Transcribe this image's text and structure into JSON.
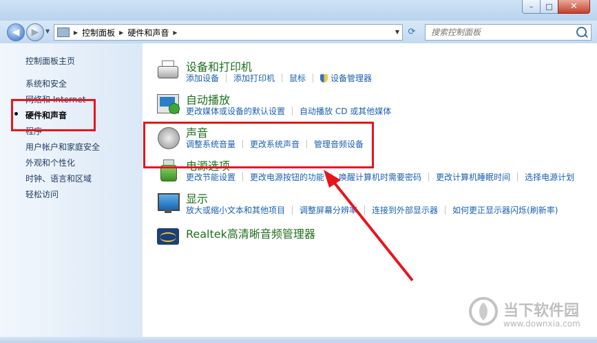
{
  "window": {
    "minimize": "–",
    "maximize": "□",
    "close": "✕"
  },
  "nav": {
    "breadcrumb": [
      "控制面板",
      "硬件和声音"
    ],
    "search_placeholder": "搜索控制面板"
  },
  "sidebar": {
    "items": [
      "控制面板主页",
      "系统和安全",
      "网络和 Internet",
      "硬件和声音",
      "程序",
      "用户帐户和家庭安全",
      "外观和个性化",
      "时钟、语言和区域",
      "轻松访问"
    ],
    "selected": "硬件和声音"
  },
  "categories": [
    {
      "title": "设备和打印机",
      "icon": "printer-icon",
      "links": [
        "添加设备",
        "添加打印机",
        "鼠标",
        "设备管理器"
      ]
    },
    {
      "title": "自动播放",
      "icon": "autoplay-icon",
      "links": [
        "更改媒体或设备的默认设置",
        "自动播放 CD 或其他媒体"
      ]
    },
    {
      "title": "声音",
      "icon": "speaker-icon",
      "links": [
        "调整系统音量",
        "更改系统声音",
        "管理音频设备"
      ]
    },
    {
      "title": "电源选项",
      "icon": "power-icon",
      "links": [
        "更改节能设置",
        "更改电源按钮的功能",
        "唤醒计算机时需要密码",
        "更改计算机睡眠时间",
        "选择电源计划"
      ]
    },
    {
      "title": "显示",
      "icon": "display-icon",
      "links": [
        "放大或缩小文本和其他项目",
        "调整屏幕分辨率",
        "连接到外部显示器",
        "如何更正显示器闪烁(刷新率)"
      ]
    },
    {
      "title": "Realtek高清晰音频管理器",
      "icon": "realtek-icon",
      "links": []
    }
  ],
  "colors": {
    "annotation": "#e8141d",
    "link": "#1a5fb4",
    "category_title": "#1e6e1e"
  },
  "watermark": {
    "name": "当下软件园",
    "url": "www.downxia.com"
  }
}
